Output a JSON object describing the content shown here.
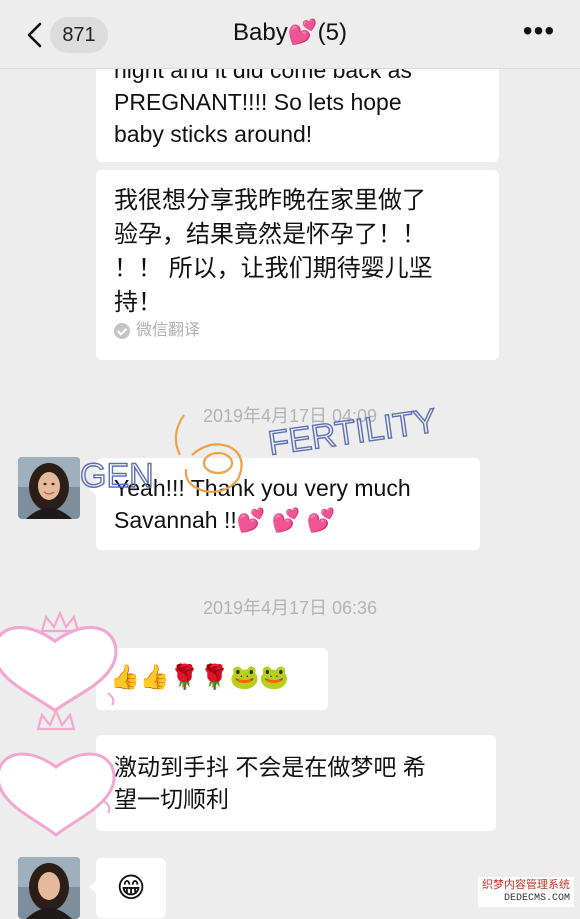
{
  "header": {
    "unread_count": "871",
    "title": "Baby💕(5)",
    "more_label": "•••"
  },
  "messages": {
    "m1_en_lines": [
      "night and it did come back as",
      "PREGNANT!!!! So lets hope",
      "baby sticks around!"
    ],
    "m2_zh_lines": [
      "我很想分享我昨晚在家里做了",
      "验孕，结果竟然是怀孕了！！",
      "！！ 所以，让我们期待婴儿坚",
      "持！"
    ],
    "translate_label": "微信翻译",
    "ts1": "2019年4月17日 04:09",
    "m3_lines": [
      "Yeah!!! Thank you very much",
      "Savannah !!💕 💕 💕"
    ],
    "ts2": "2019年4月17日 06:36",
    "m4_emojis": "👍👍🌹🌹🐸🐸",
    "m5_lines": [
      "激动到手抖 不会是在做梦吧 希",
      "望一切顺利"
    ],
    "m6_emoji": "😁"
  },
  "watermark": {
    "left": "GEN",
    "right": "FERTILITY"
  },
  "corner": {
    "line1": "织梦内容管理系统",
    "line2": "DEDECMS.COM"
  },
  "colors": {
    "background": "#ededed",
    "bubble": "#ffffff",
    "timestamp": "#b3b3b3",
    "watermark_blue": "#5c6fb5",
    "watermark_orange": "#f0a04b",
    "heart_pink": "#f3a6cf"
  }
}
